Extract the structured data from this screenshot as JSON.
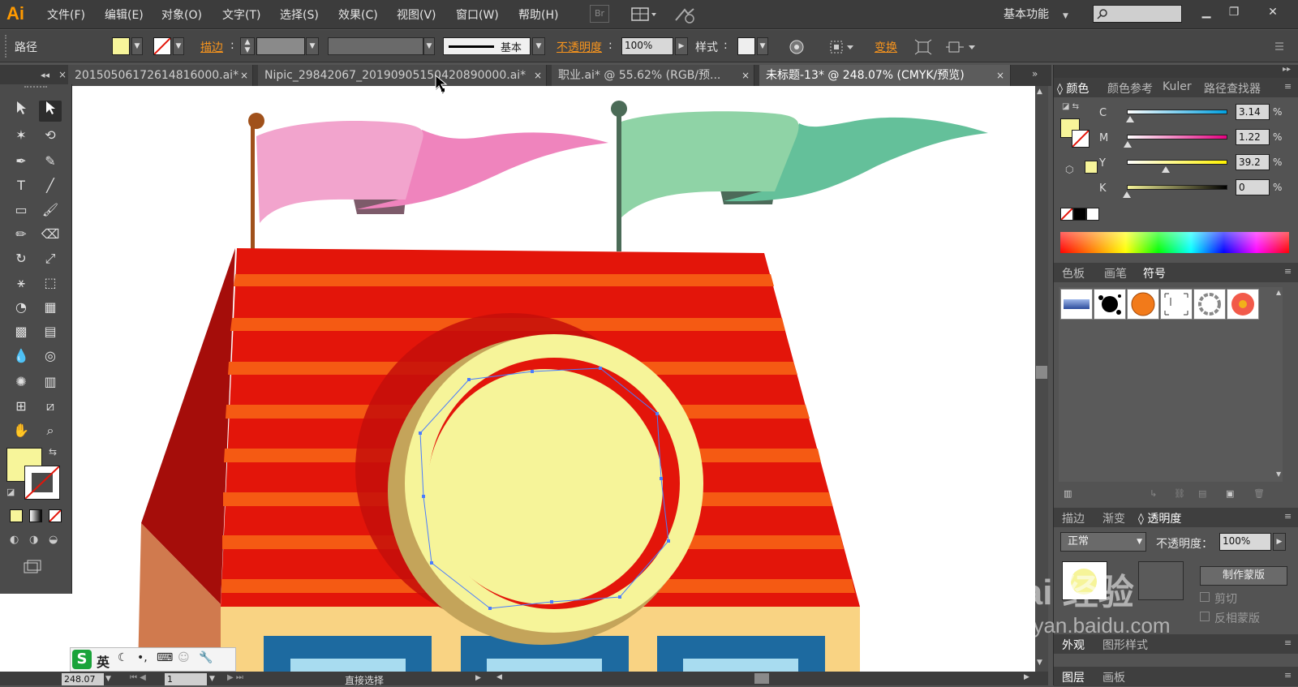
{
  "app": {
    "logo": "Ai"
  },
  "menu": {
    "items": [
      "文件(F)",
      "编辑(E)",
      "对象(O)",
      "文字(T)",
      "选择(S)",
      "效果(C)",
      "视图(V)",
      "窗口(W)",
      "帮助(H)"
    ],
    "br_label": "Br",
    "workspace": "基本功能",
    "search_icon": "search-icon"
  },
  "control": {
    "object_type": "路径",
    "stroke_label": "描边",
    "stroke_style": "基本",
    "opacity_label": "不透明度",
    "opacity_value": "100%",
    "style_label": "样式",
    "transform_label": "变换",
    "fill_color": "#f7f59a"
  },
  "tabs": [
    {
      "label": "20150506172614816000.ai*",
      "active": false
    },
    {
      "label": "Nipic_29842067_20190905150420890000.ai*",
      "active": false
    },
    {
      "label": "职业.ai* @ 55.62% (RGB/预...",
      "active": false
    },
    {
      "label": "未标题-13* @ 248.07% (CMYK/预览)",
      "active": true
    }
  ],
  "close_glyph": "×",
  "color_panel": {
    "tabs": [
      "颜色",
      "颜色参考",
      "Kuler",
      "路径查找器"
    ],
    "channels": [
      {
        "name": "C",
        "value": "3.14",
        "level": 0.0314
      },
      {
        "name": "M",
        "value": "1.22",
        "level": 0.0122
      },
      {
        "name": "Y",
        "value": "39.2",
        "level": 0.392
      },
      {
        "name": "K",
        "value": "0",
        "level": 0
      }
    ],
    "percent": "%",
    "fill_color": "#f7f59a"
  },
  "swatch_panel": {
    "tabs": [
      "色板",
      "画笔",
      "符号"
    ],
    "active_tab": "符号"
  },
  "transparency_panel": {
    "tabs": [
      "描边",
      "渐变",
      "透明度"
    ],
    "blend_mode": "正常",
    "opacity_label": "不透明度：",
    "opacity_value": "100%",
    "make_mask_button": "制作蒙版",
    "clip_label": "剪切",
    "invert_mask_label": "反相蒙版"
  },
  "bottom_panels": {
    "appearance_tabs": [
      "外观",
      "图形样式"
    ],
    "layer_tabs": [
      "图层",
      "画板"
    ]
  },
  "status": {
    "zoom": "248.07",
    "page": "1",
    "tool": "直接选择"
  },
  "ime": {
    "lang": "英"
  },
  "watermark": {
    "text": "Bai 经验",
    "url": "jingyan.baidu.com"
  },
  "artwork_colors": {
    "roof_red": "#e3150a",
    "roof_stripe": "#f55a13",
    "roof_shadow": "#a50d0a",
    "cream": "#f6f499",
    "wall": "#f9d383",
    "window_blue": "#1d6aa0",
    "pink_flag": "#f2a2c9",
    "green_flag": "#8fd3a6"
  }
}
